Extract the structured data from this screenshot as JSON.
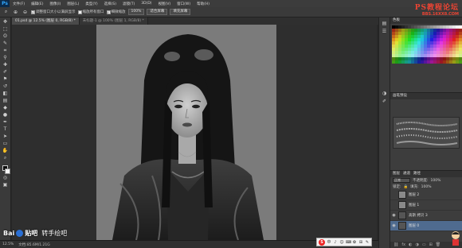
{
  "app": {
    "logo": "Ps"
  },
  "menu": [
    "文件(F)",
    "编辑(E)",
    "图像(I)",
    "图层(L)",
    "类型(Y)",
    "选择(S)",
    "滤镜(T)",
    "3D(D)",
    "视图(V)",
    "窗口(W)",
    "帮助(H)"
  ],
  "options": {
    "resize_windows": "调整窗口大小以满屏显示",
    "zoom_all": "缩放所有窗口",
    "scrubby_zoom": "细微缩放",
    "btn_100": "100%",
    "btn_fit": "适合屏幕",
    "btn_fill": "填充屏幕"
  },
  "watermark": {
    "title": "PS教程论坛",
    "url": "BBS.16XX8.COM"
  },
  "tabs": [
    {
      "label": "01.psd @ 12.5% (图层 0, RGB/8) *",
      "active": true
    },
    {
      "label": "未标题-1 @ 100% (图层 1, RGB/8) *",
      "active": false
    }
  ],
  "status": {
    "zoom": "12.5%",
    "doc": "文档:85.6M/1.21G"
  },
  "baidu": {
    "brand": "Bai",
    "brand2": "贴吧",
    "sub": "转手绘吧"
  },
  "panels": {
    "swatches_title": "色板",
    "brush_title": "画笔预设",
    "layers_title": "图层",
    "layers_tab2": "通道",
    "layers_tab3": "路径",
    "blend_mode": "正常",
    "opacity_label": "不透明度:",
    "opacity": "100%",
    "lock_label": "锁定:",
    "fill_label": "填充:",
    "fill": "100%",
    "layers": [
      {
        "name": "图层 2",
        "visible": false,
        "selected": false,
        "portrait": false
      },
      {
        "name": "图层 1",
        "visible": false,
        "selected": false,
        "portrait": false
      },
      {
        "name": "高斯 拷贝 3",
        "visible": true,
        "selected": false,
        "portrait": true
      },
      {
        "name": "图层 0",
        "visible": true,
        "selected": true,
        "portrait": true
      }
    ]
  },
  "ime": {
    "logo": "S",
    "items": [
      "中",
      "♪",
      "☺",
      "⌨",
      "✿",
      "⊞",
      "✎"
    ]
  },
  "colors": {
    "accent": "#31a8ff",
    "watermark": "#e43",
    "selection": "#4f6b8f"
  }
}
